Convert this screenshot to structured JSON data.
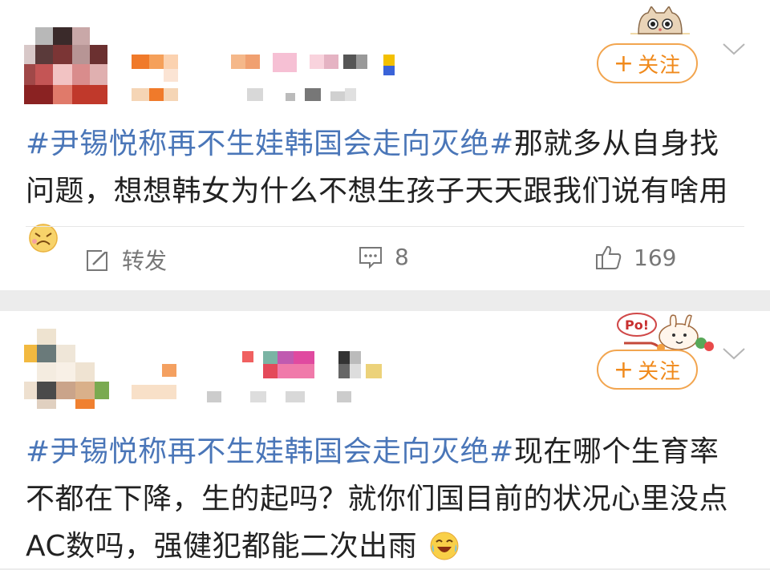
{
  "posts": [
    {
      "follow_label": "关注",
      "follow_plus": "+",
      "topic": "#尹锡悦称再不生娃韩国会走向灭绝#",
      "body": "那就多从自身找问题，想想韩女为什么不想生孩子天天跟我们说有啥用",
      "emoji": "doge-face-icon",
      "actions": {
        "repost_label": "转发",
        "comment_count": "8",
        "like_count": "169"
      }
    },
    {
      "follow_label": "关注",
      "follow_plus": "+",
      "topic": "#尹锡悦称再不生娃韩国会走向灭绝#",
      "body": "现在哪个生育率不都在下降，生的起吗？就你们国目前的状况心里没点AC数吗，强健犯都能二次出雨",
      "emoji": "laugh-cry-face-icon",
      "badge_text": "Po!"
    }
  ],
  "colors": {
    "topic": "#4a76b8",
    "follow": "#f08a1c",
    "follow_border": "#f2a54f"
  }
}
